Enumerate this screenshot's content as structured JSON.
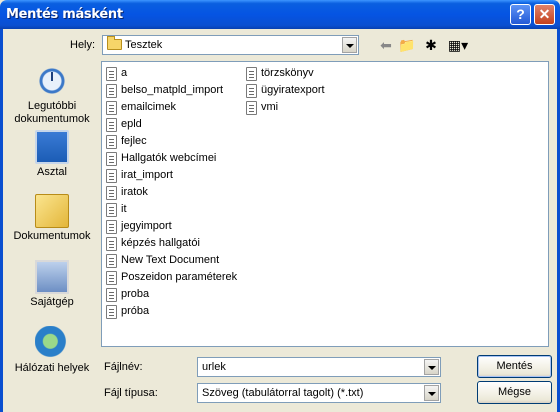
{
  "window": {
    "title": "Mentés másként"
  },
  "toolbar": {
    "location_label": "Hely:",
    "location_value": "Tesztek"
  },
  "places": [
    {
      "label": "Legutóbbi dokumentumok",
      "icon": "recent-documents-icon"
    },
    {
      "label": "Asztal",
      "icon": "desktop-icon"
    },
    {
      "label": "Dokumentumok",
      "icon": "my-documents-icon"
    },
    {
      "label": "Sajátgép",
      "icon": "my-computer-icon"
    },
    {
      "label": "Hálózati helyek",
      "icon": "network-places-icon"
    }
  ],
  "files_col1": [
    "a",
    "belso_matpld_import",
    "emailcimek",
    "epld",
    "fejlec",
    "Hallgatók webcímei",
    "irat_import",
    "iratok",
    "it",
    "jegyimport",
    "képzés hallgatói",
    "New Text Document",
    "Poszeidon paraméterek",
    "proba",
    "próba"
  ],
  "files_col2": [
    "törzskönyv",
    "ügyiratexport",
    "vmi"
  ],
  "form": {
    "filename_label": "Fájlnév:",
    "filename_value": "urlek",
    "filetype_label": "Fájl típusa:",
    "filetype_value": "Szöveg (tabulátorral tagolt) (*.txt)"
  },
  "buttons": {
    "save": "Mentés",
    "cancel": "Mégse"
  }
}
